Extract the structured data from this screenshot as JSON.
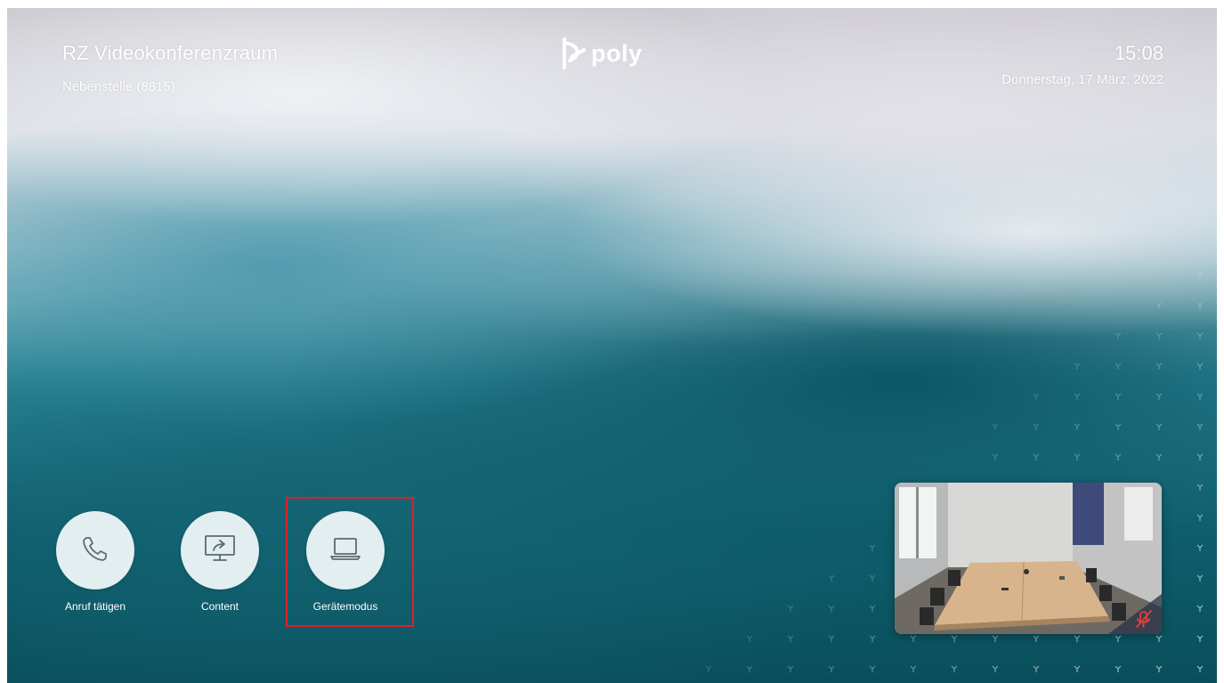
{
  "header": {
    "room_name": "RZ Videokonferenzraum",
    "extension": "Nebenstelle (8815)",
    "brand": "poly",
    "time": "15:08",
    "date": "Donnerstag, 17 März. 2022"
  },
  "actions": [
    {
      "label": "Anruf tätigen",
      "icon": "phone-icon"
    },
    {
      "label": "Content",
      "icon": "screen-share-icon"
    },
    {
      "label": "Gerätemodus",
      "icon": "laptop-icon"
    }
  ],
  "self_view": {
    "icon": "microphone-muted-icon",
    "mute_color": "#e04040"
  },
  "colors": {
    "highlight": "#e0202a",
    "button_fill": "#e2eef0",
    "icon_stroke": "#5b6b70"
  }
}
